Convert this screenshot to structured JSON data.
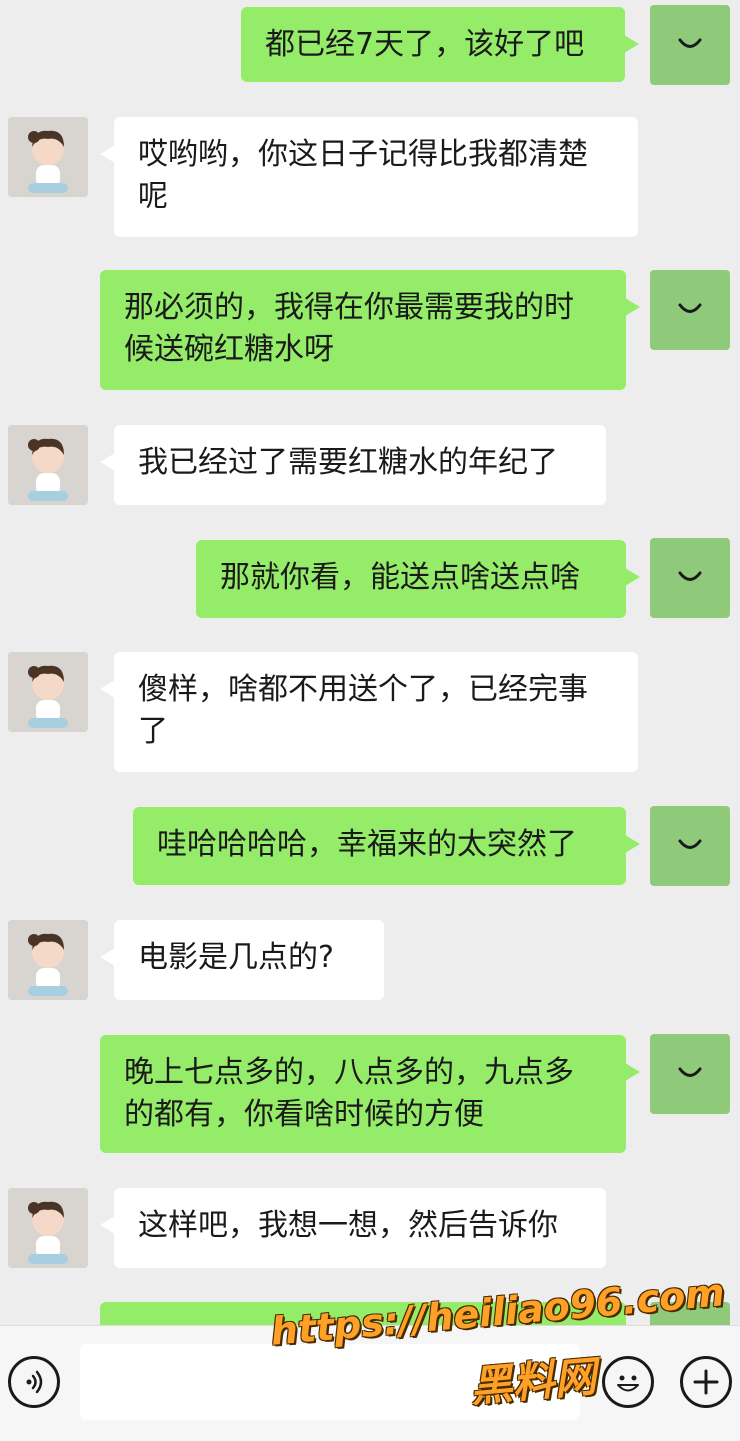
{
  "messages": [
    {
      "side": "right",
      "text": "都已经7天了，该好了吧"
    },
    {
      "side": "left",
      "text": "哎哟哟，你这日子记得比我都清楚呢"
    },
    {
      "side": "right",
      "text": "那必须的，我得在你最需要我的时候送碗红糖水呀"
    },
    {
      "side": "left",
      "text": "我已经过了需要红糖水的年纪了"
    },
    {
      "side": "right",
      "text": "那就你看，能送点啥送点啥"
    },
    {
      "side": "left",
      "text": "傻样，啥都不用送个了，已经完事了"
    },
    {
      "side": "right",
      "text": "哇哈哈哈哈，幸福来的太突然了"
    },
    {
      "side": "left",
      "text": "电影是几点的?"
    },
    {
      "side": "right",
      "text": "晚上七点多的，八点多的，九点多的都有，你看啥时候的方便"
    },
    {
      "side": "left",
      "text": "这样吧，我想一想，然后告诉你"
    },
    {
      "side": "right",
      "text": ""
    }
  ],
  "toolbar": {
    "voice_icon": "voice-icon",
    "emoji_icon": "emoji-icon",
    "plus_icon": "plus-icon"
  },
  "watermark": {
    "url": "https://heiliao96.com",
    "name": "黑料网"
  },
  "colors": {
    "background": "#ededed",
    "bubble_me": "#95ec69",
    "bubble_other": "#ffffff",
    "watermark": "#ffa126"
  }
}
